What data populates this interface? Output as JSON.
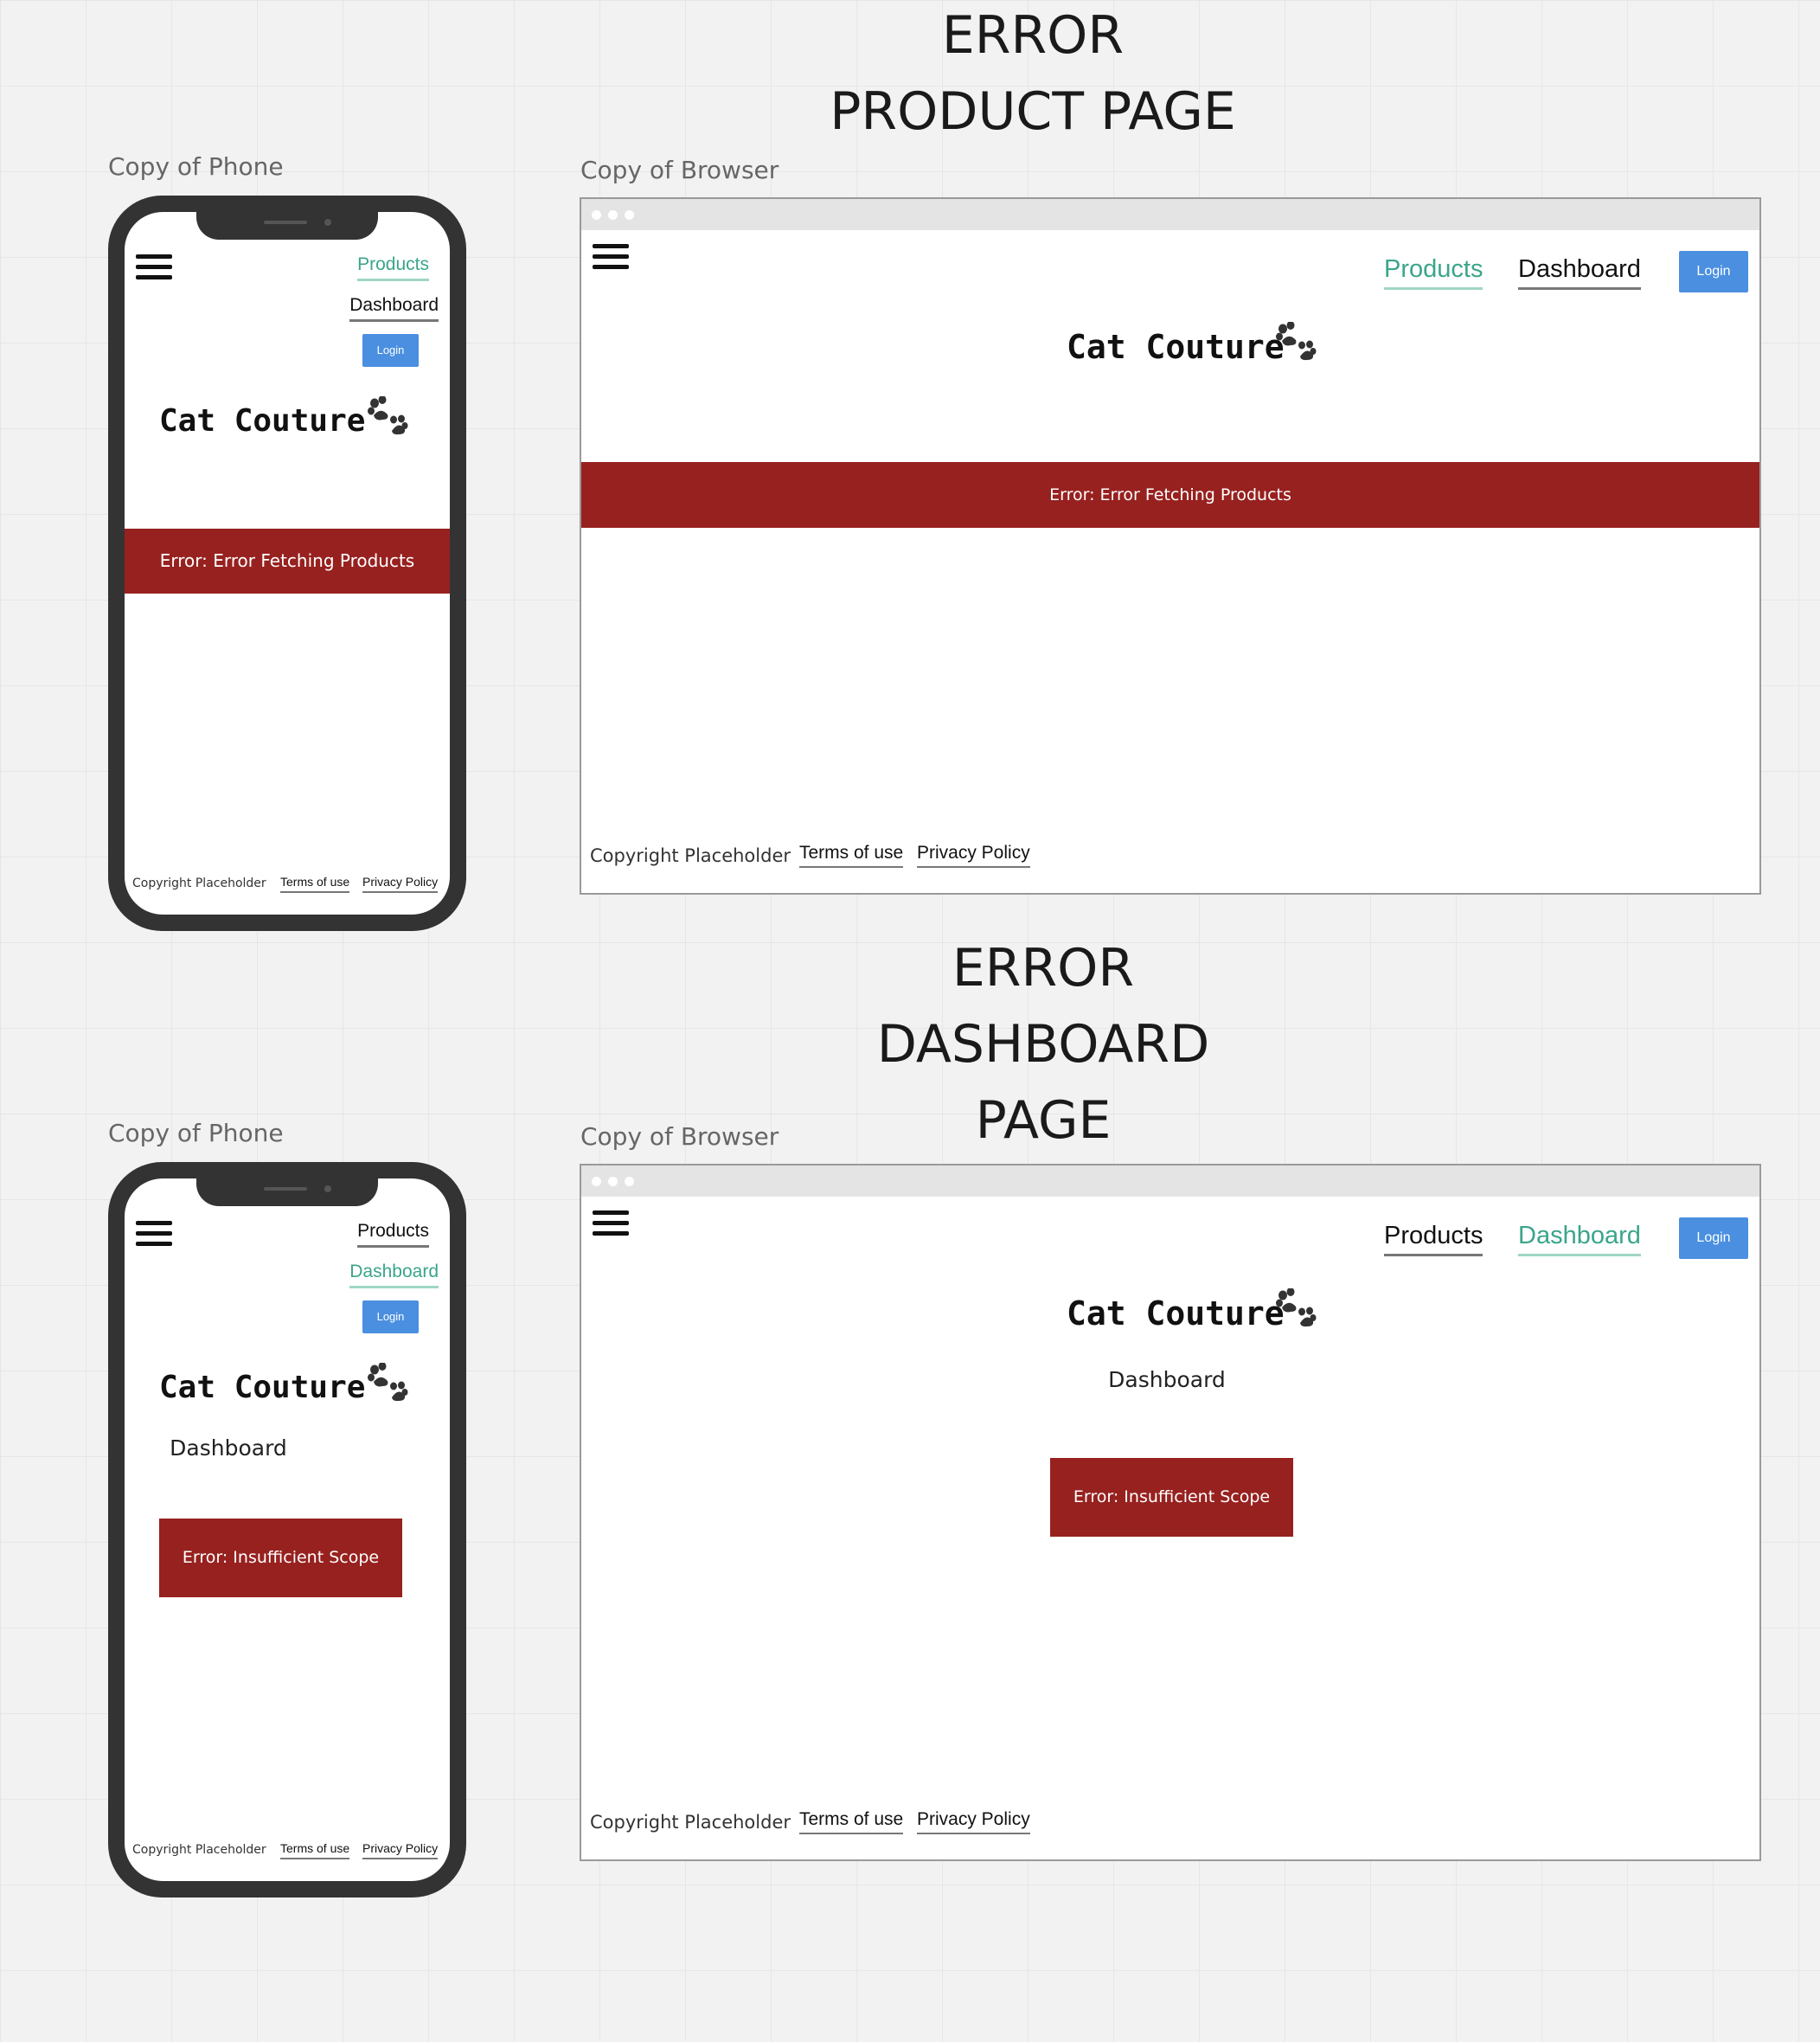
{
  "sections": [
    {
      "title_lines": [
        "ERROR",
        "PRODUCT PAGE"
      ]
    },
    {
      "title_lines": [
        "ERROR",
        "DASHBOARD",
        "PAGE"
      ]
    }
  ],
  "frames": {
    "phone_label": "Copy of Phone",
    "browser_label": "Copy of Browser"
  },
  "nav": {
    "products": "Products",
    "dashboard": "Dashboard",
    "login": "Login"
  },
  "brand": {
    "name": "Cat Couture",
    "logo_icon": "paw-print-icon"
  },
  "product_page": {
    "error": "Error: Error Fetching Products",
    "active_nav": "products"
  },
  "dashboard_page": {
    "heading": "Dashboard",
    "error": "Error: Insufficient Scope",
    "active_nav": "dashboard"
  },
  "footer": {
    "copyright": "Copyright Placeholder",
    "terms": "Terms of use",
    "privacy": "Privacy Policy"
  },
  "colors": {
    "accent_green": "#3aa58a",
    "error_red": "#97211f",
    "login_blue": "#4a8fe0",
    "device_frame": "#333333"
  }
}
